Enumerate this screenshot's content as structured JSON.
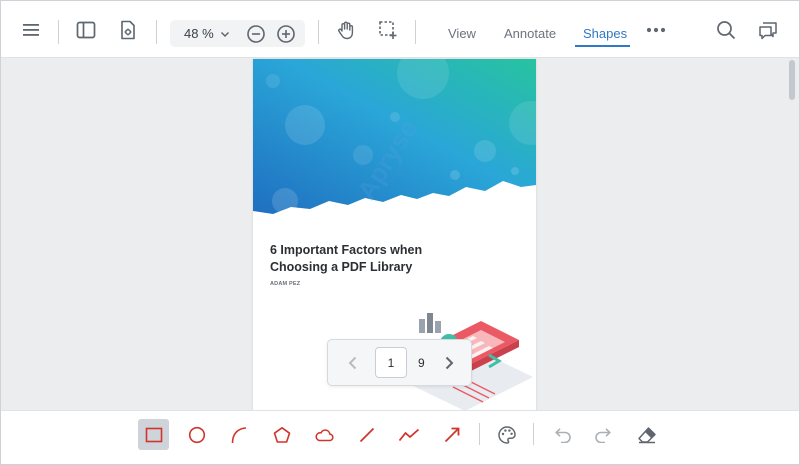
{
  "toolbar": {
    "zoom": {
      "value": "48 %"
    },
    "tabs": [
      {
        "label": "View",
        "active": false
      },
      {
        "label": "Annotate",
        "active": false
      },
      {
        "label": "Shapes",
        "active": true
      }
    ],
    "icons": {
      "menu": "hamburger-menu-icon",
      "panel": "left-panel-toggle-icon",
      "settings": "document-settings-icon",
      "zoom_dropdown": "chevron-down-icon",
      "zoom_out": "zoom-out-icon",
      "zoom_in": "zoom-in-icon",
      "pan": "pan-hand-icon",
      "select": "area-select-icon",
      "more": "more-dots-icon",
      "search": "search-icon",
      "comments": "comments-icon"
    }
  },
  "document": {
    "title_line1": "6 Important Factors when",
    "title_line2": "Choosing a PDF Library",
    "author": "ADAM PEZ",
    "watermark": "Apryse"
  },
  "page_nav": {
    "current": "1",
    "total": "9"
  },
  "shapes_toolbar": {
    "tools": [
      {
        "name": "rectangle-tool",
        "active": true
      },
      {
        "name": "ellipse-tool",
        "active": false
      },
      {
        "name": "arc-tool",
        "active": false
      },
      {
        "name": "polygon-tool",
        "active": false
      },
      {
        "name": "cloud-tool",
        "active": false
      },
      {
        "name": "line-tool",
        "active": false
      },
      {
        "name": "polyline-tool",
        "active": false
      },
      {
        "name": "arrow-tool",
        "active": false
      }
    ],
    "actions": [
      "style-palette",
      "undo",
      "redo",
      "eraser"
    ]
  },
  "colors": {
    "accent": "#2f79c5",
    "shape_red": "#d0342c",
    "icon_gray": "#5f666e",
    "canvas_bg": "#ebedef"
  }
}
